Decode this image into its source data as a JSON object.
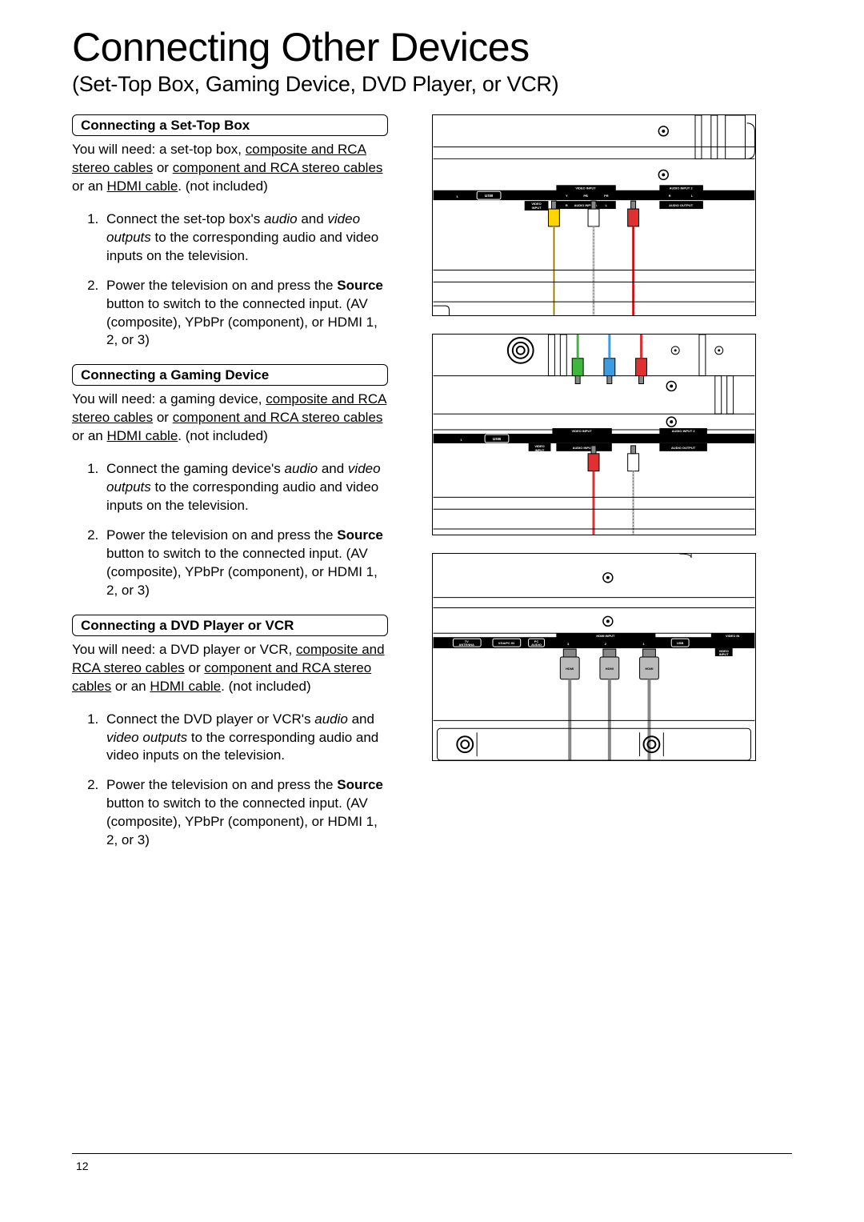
{
  "title": "Connecting Other Devices",
  "subtitle": "(Set-Top Box, Gaming Device, DVD Player, or VCR)",
  "page_number": "12",
  "sections": [
    {
      "header": "Connecting a Set-Top Box",
      "intro_pre": "You will need: a set-top box, ",
      "link1": "composite and RCA stereo cables",
      "mid1": " or ",
      "link2": "component and RCA stereo cables",
      "mid2": " or an ",
      "link3": "HDMI cable",
      "intro_post": ". (not included)",
      "step1_a": "Connect the set-top box's ",
      "step1_i1": "audio",
      "step1_b": " and ",
      "step1_i2": "video outputs",
      "step1_c": " to the corresponding audio and video inputs on the television.",
      "step2_a": "Power the television on and press the ",
      "step2_bold": "Source",
      "step2_b": " button to switch to the connected input. (AV (composite), YPbPr (component), or HDMI 1, 2, or 3)"
    },
    {
      "header": "Connecting a Gaming Device",
      "intro_pre": "You will need: a gaming device, ",
      "link1": "composite and RCA stereo cables",
      "mid1": " or ",
      "link2": "component and RCA stereo cables",
      "mid2": " or an ",
      "link3": "HDMI cable",
      "intro_post": ". (not included)",
      "step1_a": "Connect the gaming device's ",
      "step1_i1": "audio",
      "step1_b": " and ",
      "step1_i2": "video outputs",
      "step1_c": " to the corresponding audio and video inputs on the television.",
      "step2_a": "Power the television on and press the ",
      "step2_bold": "Source",
      "step2_b": " button to switch to the connected input. (AV (composite), YPbPr (component), or HDMI 1, 2, or 3)"
    },
    {
      "header": "Connecting a DVD Player or VCR",
      "intro_pre": "You will need: a DVD player or VCR, ",
      "link1": "composite and RCA stereo cables",
      "mid1": " or ",
      "link2": "component and RCA stereo cables",
      "mid2": " or an ",
      "link3": "HDMI cable",
      "intro_post": ". (not included)",
      "step1_a": "Connect the DVD player or VCR's ",
      "step1_i1": "audio",
      "step1_b": " and ",
      "step1_i2": "video outputs",
      "step1_c": " to the corresponding audio and video inputs on the television.",
      "step2_a": "Power the television on and press the ",
      "step2_bold": "Source",
      "step2_b": " button to switch to the connected input. (AV (composite), YPbPr (component), or HDMI 1, 2, or 3)"
    }
  ],
  "diag_labels": {
    "usb": "USB",
    "video_input": "VIDEO INPUT",
    "audio_input_1": "AUDIO INPUT 1",
    "audio_input_2": "AUDIO INPUT 2",
    "audio_output": "AUDIO OUTPUT",
    "video_in": "VIDEO IN",
    "y": "Y",
    "pb": "PB",
    "pr": "PR",
    "r": "R",
    "l": "L",
    "tv_antenna": "TV ANTENNA",
    "vga_pc_in": "VGA/PC IN",
    "pc_audio": "PC AUDIO",
    "hdmi_input": "HDMI INPUT",
    "hdmi": "HDMI",
    "n1": "1",
    "n2": "2",
    "n3": "3",
    "video": "VIDEO",
    "audio": "AUDIO",
    "input": "INPUT"
  }
}
